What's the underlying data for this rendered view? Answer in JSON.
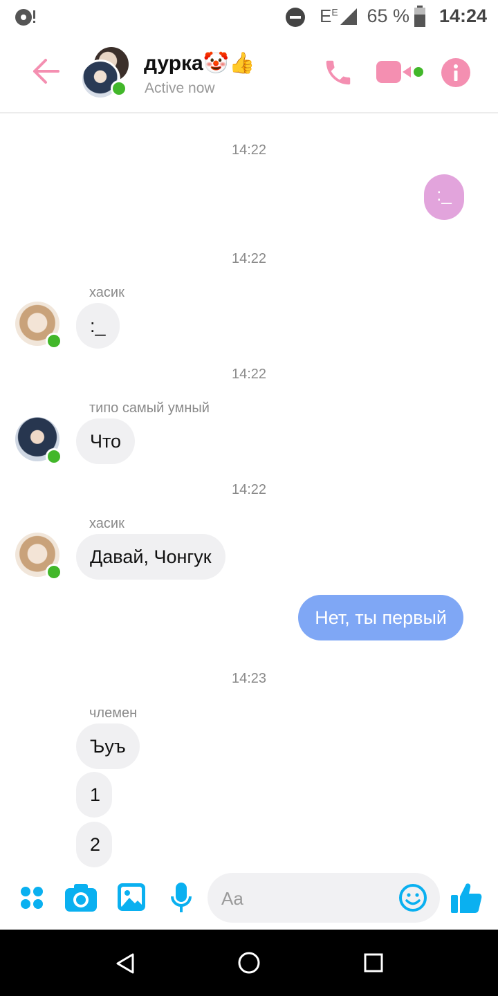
{
  "status_bar": {
    "network": "E",
    "network_sup": "E",
    "battery": "65 %",
    "time": "14:24"
  },
  "header": {
    "title": "дурка🤡👍",
    "subtitle": "Active now"
  },
  "messages": {
    "stamp1": "14:22",
    "out1": ":_",
    "stamp2": "14:22",
    "sender2": "хасик",
    "in2": ":_",
    "stamp3": "14:22",
    "sender3": "типо самый умный",
    "in3": "Что",
    "stamp4": "14:22",
    "sender4": "хасик",
    "in4": "Давай, Чонгук",
    "out5": "Нет, ты первый",
    "stamp6": "14:23",
    "sender6": "члемен",
    "in6a": "Ъуъ",
    "in6b": "1",
    "in6c": "2"
  },
  "composer": {
    "placeholder": "Aa"
  },
  "colors": {
    "accent_pink": "#f48fb1",
    "accent_blue": "#0ab0f0",
    "bubble_blue": "#7fa7f5",
    "bubble_pink": "#e2a4dc",
    "online": "#42b72a"
  },
  "icons": [
    "record-icon",
    "dnd-icon",
    "signal-icon",
    "battery-icon",
    "back-arrow-icon",
    "phone-icon",
    "video-icon",
    "info-icon",
    "apps-icon",
    "camera-icon",
    "gallery-icon",
    "mic-icon",
    "emoji-icon",
    "like-icon",
    "nav-back-icon",
    "nav-home-icon",
    "nav-recents-icon"
  ]
}
